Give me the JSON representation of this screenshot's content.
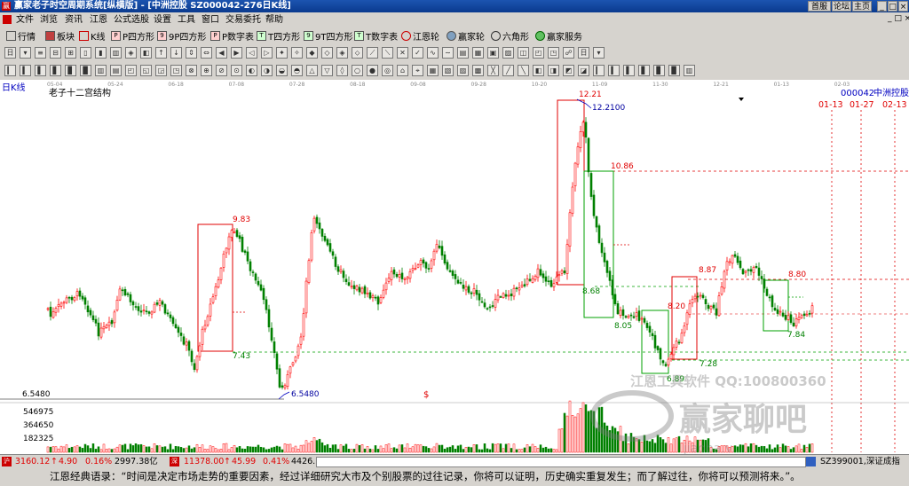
{
  "window": {
    "title": "赢家老子时空周期系统[纵横版] - [中洲控股  SZ000042-276日K线]",
    "right_buttons": [
      "首服",
      "论坛",
      "主页"
    ],
    "app_icon": "赢"
  },
  "menu": [
    "文件",
    "浏览",
    "资讯",
    "江恩",
    "公式选股",
    "设置",
    "工具",
    "窗口",
    "交易委托",
    "帮助"
  ],
  "toolbar1": [
    {
      "icon": "grid-icon",
      "label": "行情"
    },
    {
      "icon": "blocks-icon",
      "label": "板块"
    },
    {
      "icon": "candle-icon",
      "label": "K线"
    },
    {
      "icon": "p-square-icon",
      "label": "P四方形"
    },
    {
      "icon": "9p-icon",
      "label": "9P四方形"
    },
    {
      "icon": "p-text-icon",
      "label": "P数字表"
    },
    {
      "icon": "t-square-icon",
      "label": "T四方形"
    },
    {
      "icon": "9t-icon",
      "label": "9T四方形"
    },
    {
      "icon": "t-text-icon",
      "label": "T数字表"
    },
    {
      "icon": "gann-wheel-icon",
      "label": "江恩轮"
    },
    {
      "icon": "winner-wheel-icon",
      "label": "赢家轮"
    },
    {
      "icon": "hexagon-icon",
      "label": "六角形"
    },
    {
      "icon": "service-icon",
      "label": "赢家服务"
    }
  ],
  "chart_header": {
    "period": "日K线",
    "structure": "老子十二宫结构",
    "symbol": "000042",
    "name": "中洲控股",
    "right_dates": [
      "01-13",
      "01-27",
      "02-13"
    ]
  },
  "top_dates": [
    "05-04",
    "05-24",
    "06-18",
    "07-08",
    "07-28",
    "08-18",
    "09-08",
    "09-28",
    "10-20",
    "11-09",
    "11-30",
    "12-21",
    "01-13",
    "02-03"
  ],
  "chart_data": {
    "type": "candlestick",
    "price_labels": [
      {
        "text": "12.21",
        "color": "#ff0000"
      },
      {
        "text": "12.2100",
        "color": "#0000a0"
      },
      {
        "text": "10.86",
        "color": "#ff0000"
      },
      {
        "text": "9.83",
        "color": "#ff0000"
      },
      {
        "text": "8.87",
        "color": "#ff0000"
      },
      {
        "text": "8.80",
        "color": "#ff0000"
      },
      {
        "text": "8.68",
        "color": "#008000"
      },
      {
        "text": "8.20",
        "color": "#ff0000"
      },
      {
        "text": "8.05",
        "color": "#008000"
      },
      {
        "text": "7.84",
        "color": "#008000"
      },
      {
        "text": "7.43",
        "color": "#008000"
      },
      {
        "text": "7.28",
        "color": "#008000"
      },
      {
        "text": "6.89",
        "color": "#008000"
      },
      {
        "text": "6.5480",
        "color": "#0000a0"
      }
    ],
    "y_min_label": "6.5480",
    "volume_axis_labels": [
      "546975",
      "364650",
      "182325"
    ],
    "ohlc_values_shown": false
  },
  "watermark": {
    "line1": "江恩工具软件  QQ:100800360",
    "line2": "赢家聊吧",
    "line3": "jiaoba.v..."
  },
  "status": {
    "sh_index": "3160.12",
    "sh_change": "4.90",
    "sh_pct": "0.16%",
    "sh_amount": "2997.38亿",
    "sz_index": "11378.00",
    "sz_change": "45.99",
    "sz_pct": "0.41%",
    "sz_amount": "4426.54",
    "right_text": "SZ399001,深证成指"
  },
  "marquee": "江恩经典语录：“时间是决定市场走势的重要因素，经过详细研究大市及个别股票的过往记录，你将可以证明，历史确实重复发生；而了解过往，你将可以预测将来。”。",
  "colors": {
    "up": "#ff0000",
    "down": "#008000",
    "box_red": "#e00000",
    "box_green": "#00a000",
    "accent": "#0000a0"
  }
}
